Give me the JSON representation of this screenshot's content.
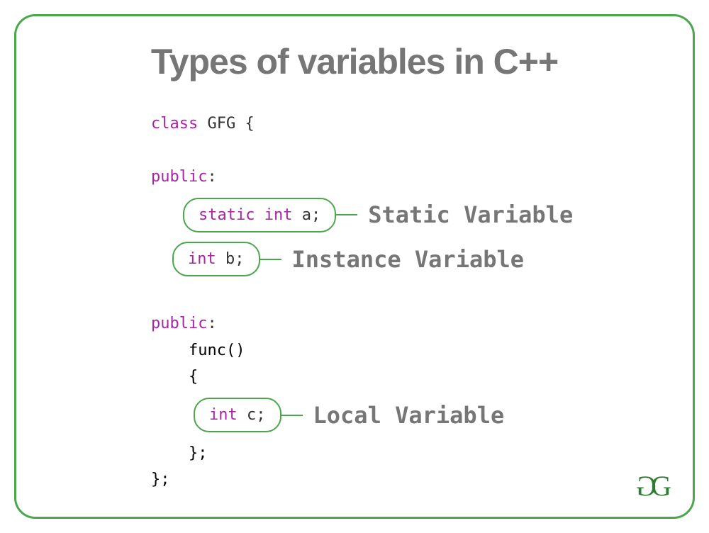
{
  "title": "Types of variables in C++",
  "code": {
    "line1_keyword": "class",
    "line1_rest": " GFG {",
    "line2": "public",
    "line2_colon": ":",
    "pill1_kw1": "static",
    "pill1_kw2": " int",
    "pill1_rest": " a;",
    "pill2_kw": "int",
    "pill2_rest": " b;",
    "line3": "public",
    "line3_colon": ":",
    "line4": "    func()",
    "line5": "    {",
    "pill3_kw": "int",
    "pill3_rest": " c;",
    "line6": "    };",
    "line7": "};"
  },
  "labels": {
    "static": "Static Variable",
    "instance": "Instance Variable",
    "local": "Local Variable"
  },
  "logo": {
    "g1": "G",
    "g2": "G"
  }
}
